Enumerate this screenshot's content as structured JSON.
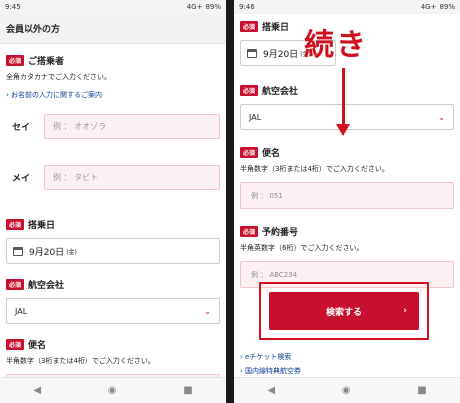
{
  "left": {
    "status": {
      "time": "9:45",
      "signal": "4G+",
      "battery": "89%"
    },
    "section_title": "会員以外の方",
    "boarder": {
      "req": "必須",
      "label": "ご搭乗者",
      "note": "全角カタカナでご入力ください。",
      "link": "お名前の入力に関するご案内"
    },
    "sei": {
      "label": "セイ",
      "placeholder": "例 ： オオゾラ"
    },
    "mei": {
      "label": "メイ",
      "placeholder": "例 ： タビト"
    },
    "date": {
      "req": "必須",
      "label": "搭乗日",
      "value": "9月20日",
      "dow": "(金)"
    },
    "airline": {
      "req": "必須",
      "label": "航空会社",
      "value": "JAL"
    },
    "flight": {
      "req": "必須",
      "label": "便名",
      "note": "半角数字（3桁または4桁）でご入力ください。"
    }
  },
  "right": {
    "status": {
      "time": "9:46",
      "signal": "4G+",
      "battery": "89%"
    },
    "date": {
      "req": "必須",
      "label": "搭乗日",
      "value": "9月20日",
      "dow": "(金)"
    },
    "overlay_text": "続き",
    "airline": {
      "req": "必須",
      "label": "航空会社",
      "value": "JAL"
    },
    "flight": {
      "req": "必須",
      "label": "便名",
      "note": "半角数字（3桁または4桁）でご入力ください。",
      "placeholder": "例 ： 051"
    },
    "booking": {
      "req": "必須",
      "label": "予約番号",
      "note": "半角英数字（6桁）でご入力ください。",
      "placeholder": "例 ： ABC234"
    },
    "search_button": "検索する",
    "links": [
      "eチケット検索",
      "国内線特典航空券"
    ]
  },
  "nav": {
    "back": "◀",
    "home": "◉",
    "recent": "■"
  },
  "colors": {
    "accent": "#c8102e",
    "pink": "#fdf0f2"
  }
}
